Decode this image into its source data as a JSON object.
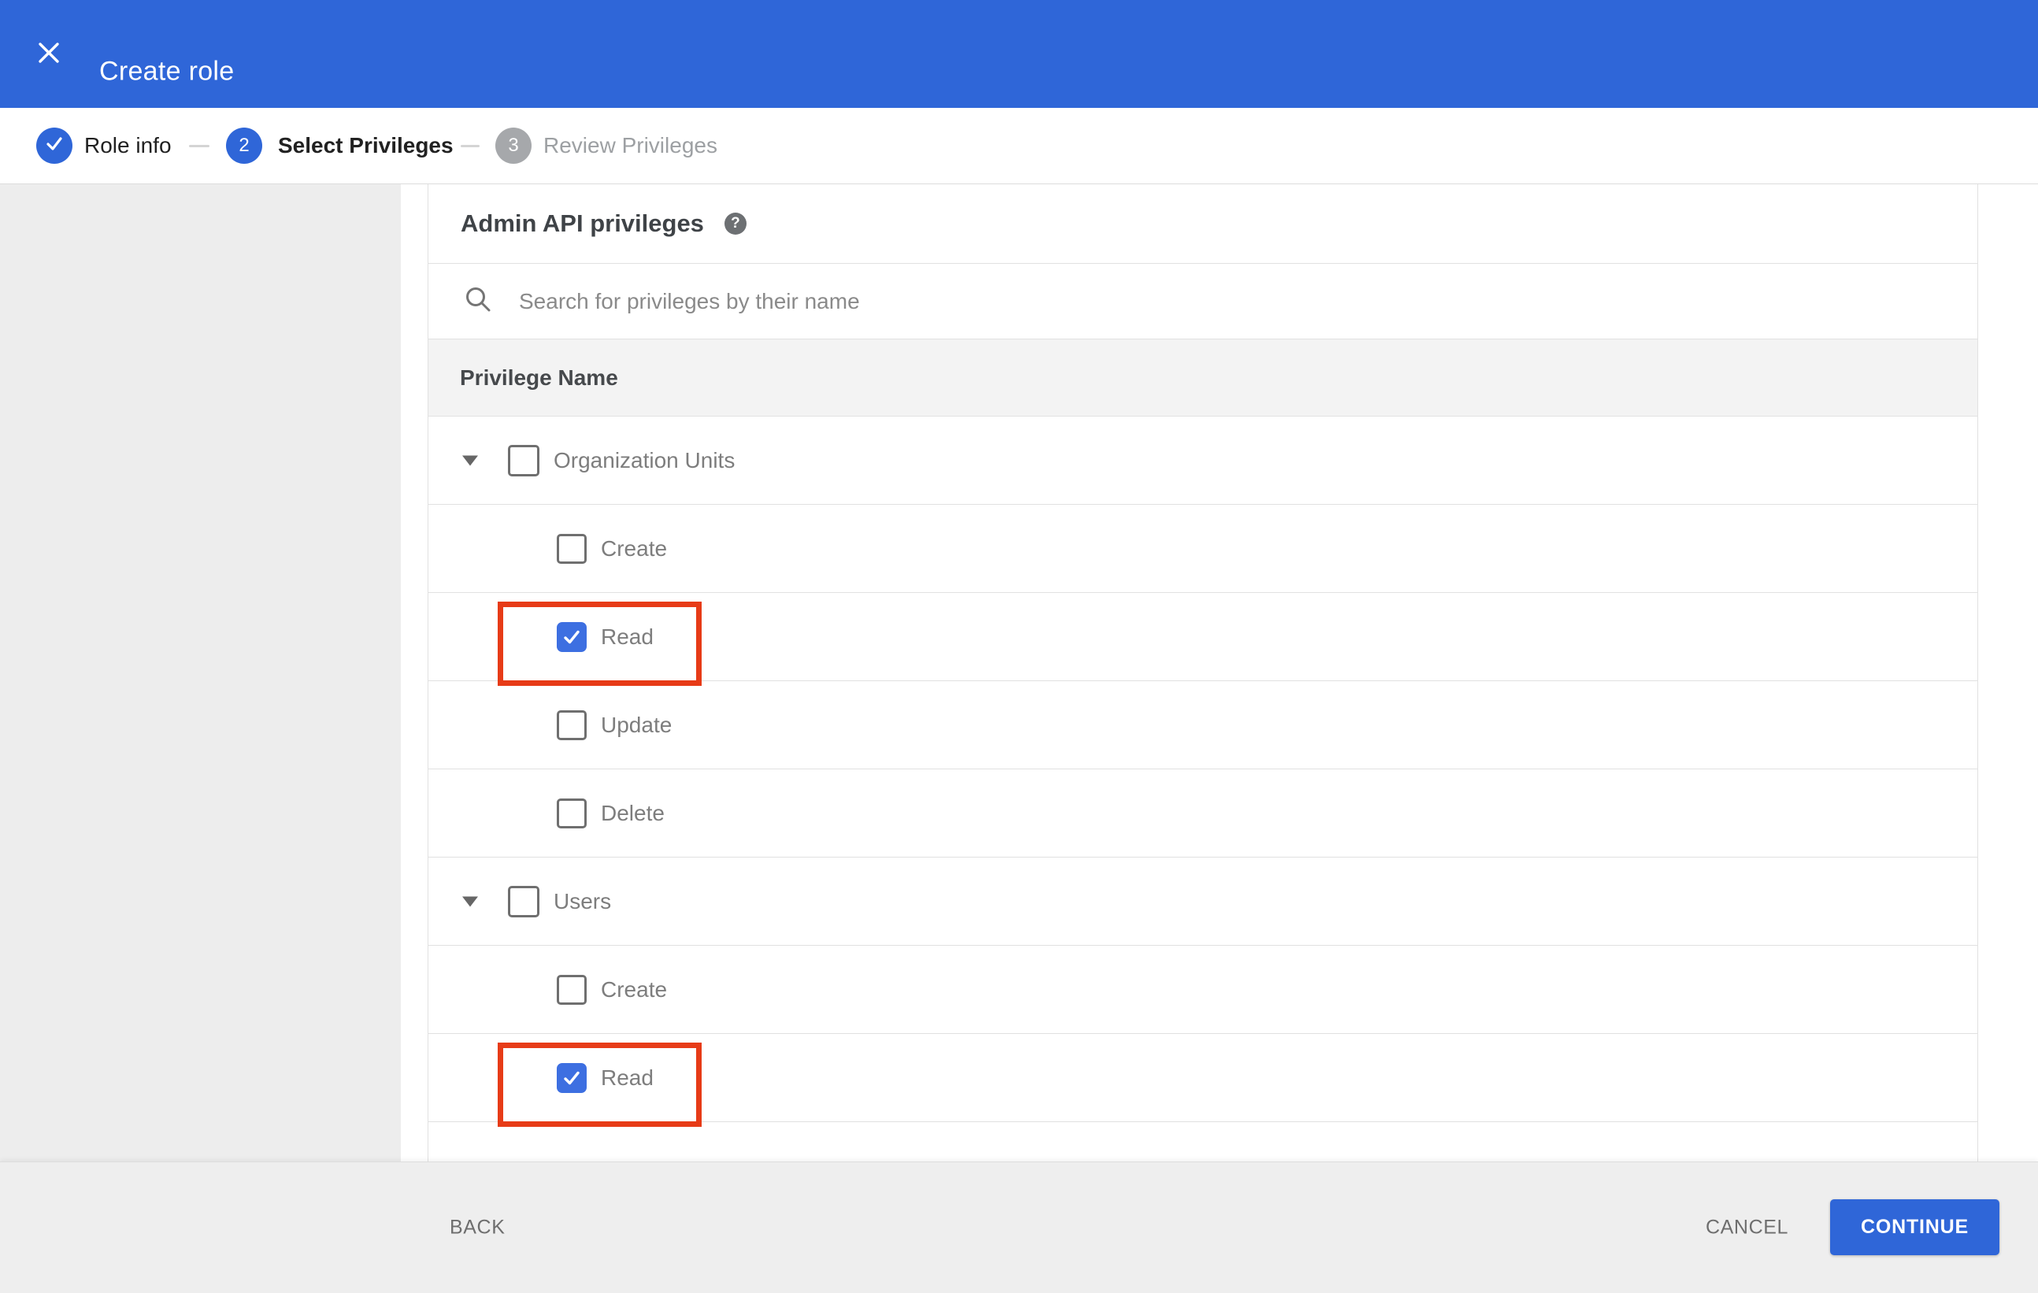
{
  "colors": {
    "primary": "#2f66d8",
    "checkbox_blue": "#3d6fe1",
    "annotation_red": "#e73b17",
    "divider": "#e1e1e1",
    "rail_bg": "#ededed",
    "footer_bg": "#eeeeee",
    "thead_bg": "#f3f3f3"
  },
  "app_bar": {
    "title": "Create role",
    "close_icon": "x-icon"
  },
  "stepper": {
    "steps": [
      {
        "number": "1",
        "label": "Role info",
        "state": "completed",
        "icon": "check-icon"
      },
      {
        "number": "2",
        "label": "Select Privileges",
        "state": "active"
      },
      {
        "number": "3",
        "label": "Review Privileges",
        "state": "upcoming"
      }
    ]
  },
  "privileges": {
    "heading": "Admin API privileges",
    "help_icon": "help-icon",
    "help_glyph": "?",
    "search_placeholder": "Search for privileges by their name",
    "column_header": "Privilege Name",
    "rows": [
      {
        "label": "Organization Units",
        "level": 0,
        "expandable": true,
        "expanded": true,
        "checked": false,
        "highlighted": false
      },
      {
        "label": "Create",
        "level": 1,
        "expandable": false,
        "checked": false,
        "highlighted": false
      },
      {
        "label": "Read",
        "level": 1,
        "expandable": false,
        "checked": true,
        "highlighted": true
      },
      {
        "label": "Update",
        "level": 1,
        "expandable": false,
        "checked": false,
        "highlighted": false
      },
      {
        "label": "Delete",
        "level": 1,
        "expandable": false,
        "checked": false,
        "highlighted": false
      },
      {
        "label": "Users",
        "level": 0,
        "expandable": true,
        "expanded": true,
        "checked": false,
        "highlighted": false
      },
      {
        "label": "Create",
        "level": 1,
        "expandable": false,
        "checked": false,
        "highlighted": false
      },
      {
        "label": "Read",
        "level": 1,
        "expandable": false,
        "checked": true,
        "highlighted": true
      }
    ]
  },
  "footer": {
    "back": "BACK",
    "cancel": "CANCEL",
    "continue": "CONTINUE"
  }
}
